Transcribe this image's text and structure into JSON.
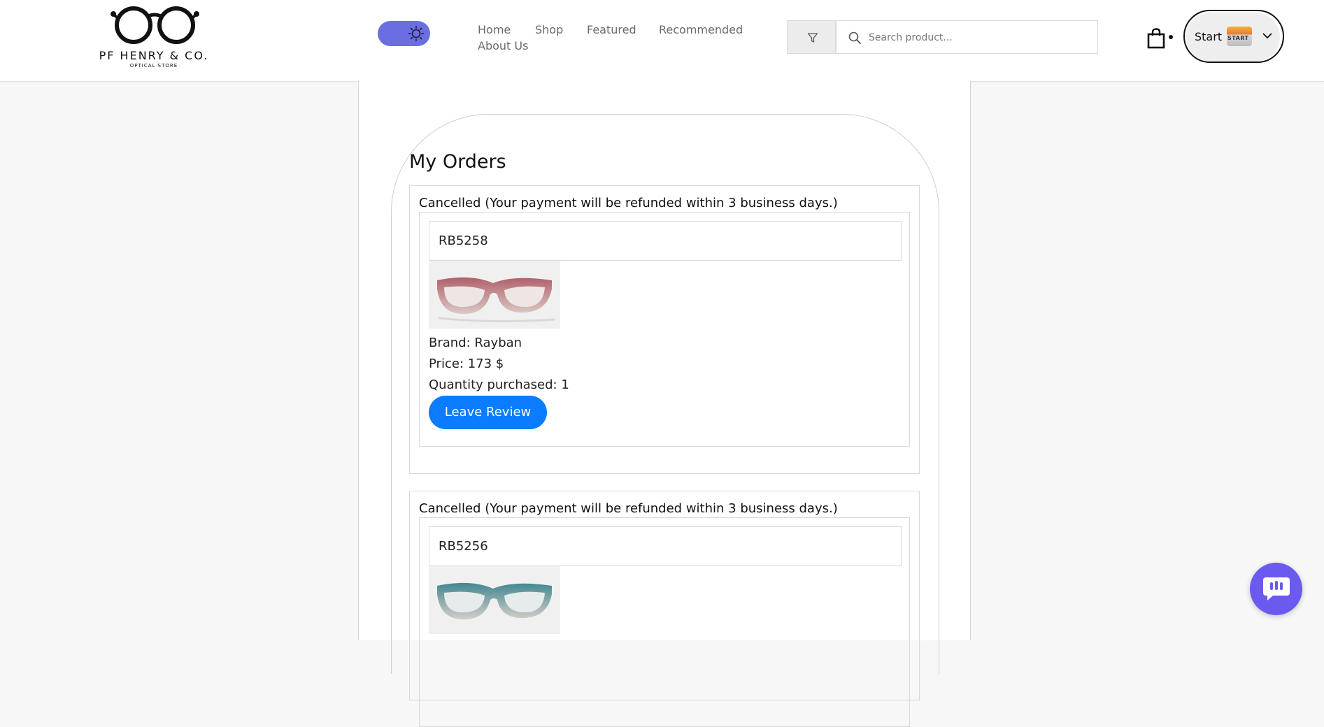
{
  "brand": {
    "name": "PF HENRY & CO.",
    "tagline": "OPTICAL STORE"
  },
  "nav": {
    "links": [
      "Home",
      "Shop",
      "Featured",
      "Recommended",
      "About Us"
    ]
  },
  "search": {
    "placeholder": "Search product..."
  },
  "user": {
    "label": "Start",
    "avatar_text": "START"
  },
  "page": {
    "title": "My Orders"
  },
  "orders": [
    {
      "status": "Cancelled (Your payment will be refunded within 3 business days.)",
      "item": {
        "name": "RB5258",
        "brand": "Brand: Rayban",
        "price": "Price: 173 $",
        "quantity": "Quantity purchased: 1",
        "frame_color": "#b86a72"
      },
      "review_label": "Leave Review"
    },
    {
      "status": "Cancelled (Your payment will be refunded within 3 business days.)",
      "item": {
        "name": "RB5256",
        "frame_color": "#3f8a94"
      }
    }
  ],
  "colors": {
    "toggle": "#6b6ee0",
    "primary_button": "#0a7cff",
    "chat_button": "#6a5af0"
  },
  "icons": [
    "sun-icon",
    "filter-icon",
    "search-icon",
    "shopping-bag-icon",
    "chevron-down-icon",
    "chat-icon",
    "glasses-logo"
  ]
}
